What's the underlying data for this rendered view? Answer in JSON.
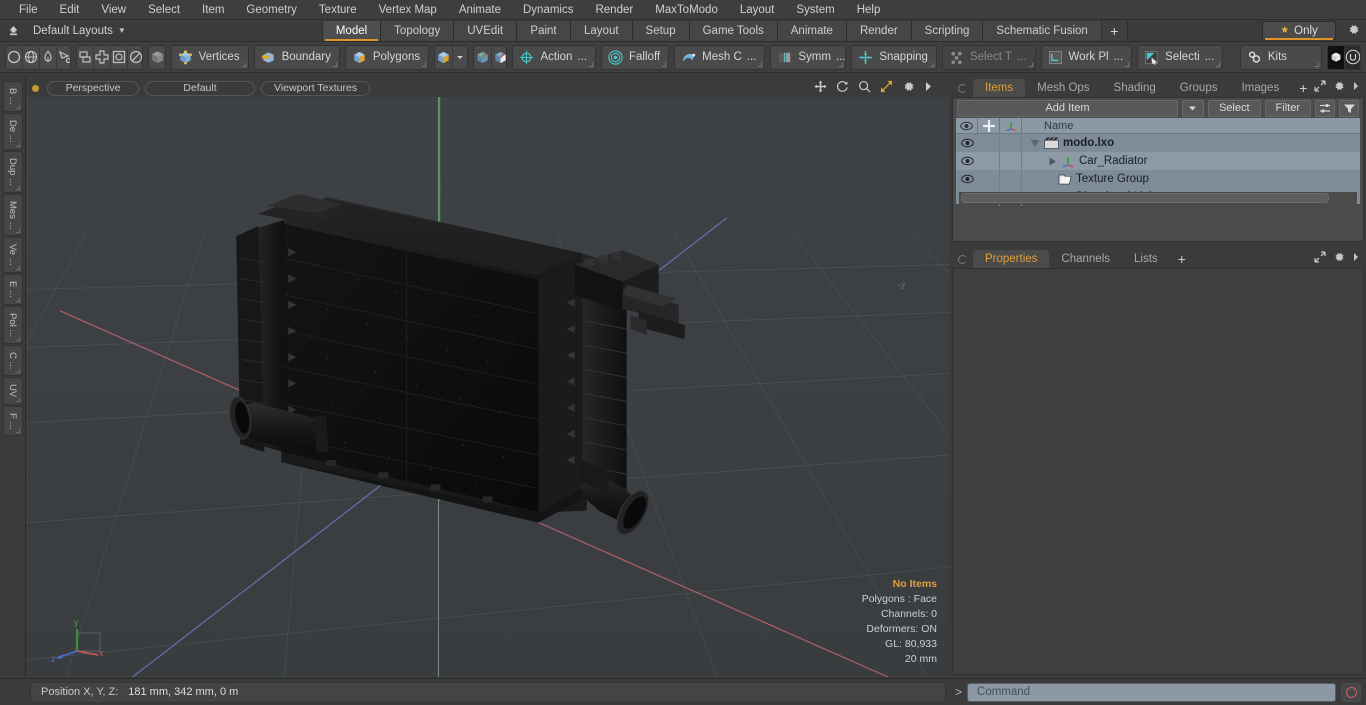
{
  "menu": {
    "items": [
      "File",
      "Edit",
      "View",
      "Select",
      "Item",
      "Geometry",
      "Texture",
      "Vertex Map",
      "Animate",
      "Dynamics",
      "Render",
      "MaxToModo",
      "Layout",
      "System",
      "Help"
    ]
  },
  "layoutbar": {
    "title": "Default Layouts",
    "caret": "▼",
    "tabs": [
      {
        "label": "Model",
        "active": true
      },
      {
        "label": "Topology",
        "active": false
      },
      {
        "label": "UVEdit",
        "active": false
      },
      {
        "label": "Paint",
        "active": false
      },
      {
        "label": "Layout",
        "active": false
      },
      {
        "label": "Setup",
        "active": false
      },
      {
        "label": "Game Tools",
        "active": false
      },
      {
        "label": "Animate",
        "active": false
      },
      {
        "label": "Render",
        "active": false
      },
      {
        "label": "Scripting",
        "active": false
      },
      {
        "label": "Schematic Fusion",
        "active": false
      }
    ],
    "add_tab_label": "+",
    "only_label": "Only",
    "star_glyph": "★"
  },
  "toolbar": {
    "shape_tools": [
      "circle-tool",
      "globe-tool",
      "pen-tool",
      "cut-tool"
    ],
    "prim_tools": [
      "mirror-tool",
      "axis-tool",
      "bound-tool",
      "ellipse-tool"
    ],
    "cube_tool": "cube-tool",
    "selection_modes": [
      {
        "label": "Vertices",
        "icon": "vertices-icon"
      },
      {
        "label": "Boundary",
        "icon": "boundary-icon"
      },
      {
        "label": "Polygons",
        "icon": "polygons-icon"
      }
    ],
    "items": [
      {
        "label": "Action",
        "suffix": "...",
        "icon": "action-center-icon"
      },
      {
        "label": "Falloff",
        "suffix": "",
        "icon": "falloff-icon"
      },
      {
        "label": "Mesh C",
        "suffix": "...",
        "icon": "mesh-constraint-icon"
      },
      {
        "label": "Symm",
        "suffix": "...",
        "icon": "symmetry-icon"
      },
      {
        "label": "Snapping",
        "suffix": "",
        "icon": "snapping-icon"
      },
      {
        "label": "Select T",
        "suffix": "...",
        "icon": "select-through-icon",
        "dim": true
      },
      {
        "label": "Work Pl",
        "suffix": "...",
        "icon": "workplane-icon"
      },
      {
        "label": "Selecti",
        "suffix": "...",
        "icon": "selection-set-icon"
      },
      {
        "label": "Kits",
        "suffix": "",
        "icon": "kits-icon"
      }
    ],
    "right_icons": [
      "modo-logo-icon",
      "unreal-logo-icon"
    ]
  },
  "left_strip": {
    "tabs": [
      "B ...",
      "De ...",
      "Dup ...",
      "Mes ...",
      "Ve ...",
      "E ...",
      "Pol ...",
      "C ...",
      "UV",
      "F ..."
    ]
  },
  "viewport": {
    "pills": [
      "Perspective",
      "Default",
      "Viewport Textures"
    ],
    "tool_icons": [
      "pan-icon",
      "rotate-icon",
      "zoom-icon",
      "fit-icon",
      "gear-icon",
      "arrow-icon"
    ],
    "axis_label": "-z",
    "gizmo": {
      "x": "x",
      "y": "y",
      "z": "z"
    },
    "status": {
      "title": "No Items",
      "lines": [
        "Polygons : Face",
        "Channels: 0",
        "Deformers: ON",
        "GL: 80,933",
        "20 mm"
      ]
    },
    "background_color": "#3c4043",
    "axis_colors": {
      "x": "#c4555b",
      "y": "#3ea93e",
      "z": "#4a6fd4"
    }
  },
  "right_panel": {
    "tabs": [
      {
        "label": "Items",
        "active": true
      },
      {
        "label": "Mesh Ops",
        "active": false
      },
      {
        "label": "Shading",
        "active": false
      },
      {
        "label": "Groups",
        "active": false
      },
      {
        "label": "Images",
        "active": false
      }
    ],
    "add_tab": "+",
    "add_item_label": "Add Item",
    "select_label": "Select",
    "filter_label": "Filter",
    "name_column": "Name",
    "items": [
      {
        "label": "modo.lxo",
        "icon": "scene-icon",
        "indent": 0,
        "bold": true,
        "expanded": true
      },
      {
        "label": "Car_Radiator",
        "icon": "mesh-axis-icon",
        "indent": 1,
        "bold": false,
        "expanded": false
      },
      {
        "label": "Texture Group",
        "icon": "texture-group-icon",
        "indent": 1,
        "bold": false
      },
      {
        "label": "Directional Light",
        "icon": "light-icon",
        "indent": 1,
        "bold": false
      }
    ],
    "bottom_tabs": [
      {
        "label": "Properties",
        "active": true
      },
      {
        "label": "Channels",
        "active": false
      },
      {
        "label": "Lists",
        "active": false
      }
    ],
    "bottom_add_tab": "+"
  },
  "statusbar": {
    "position_label": "Position X, Y, Z:",
    "position_value": "181 mm, 342 mm, 0 m",
    "command_prompt": ">",
    "command_placeholder": "Command"
  }
}
